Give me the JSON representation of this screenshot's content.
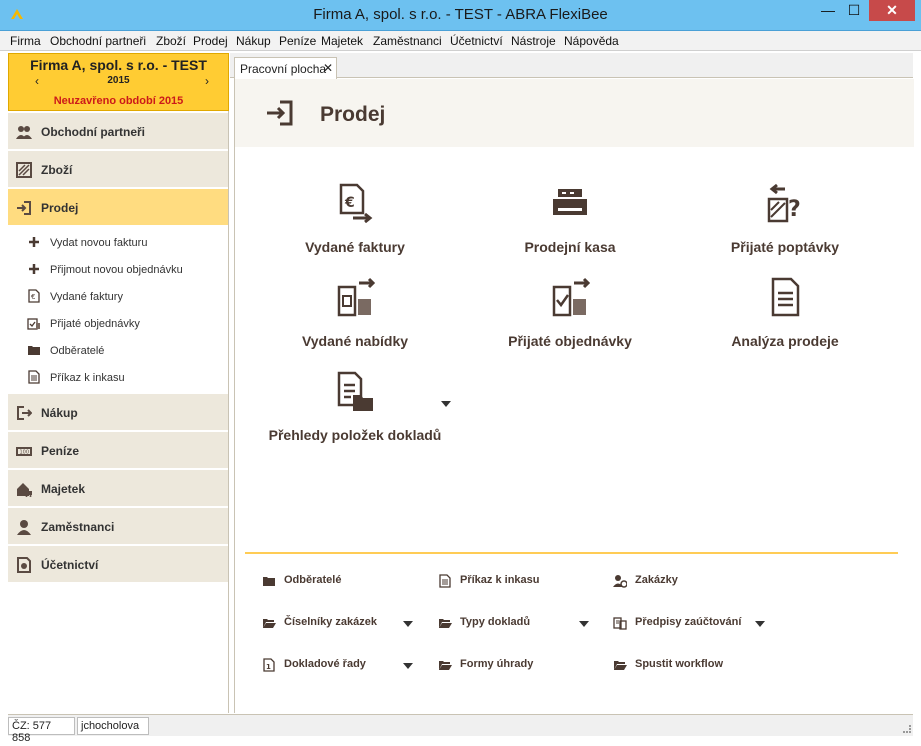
{
  "window": {
    "title": "Firma A, spol. s r.o. - TEST - ABRA FlexiBee",
    "min_glyph": "—",
    "max_glyph": "☐",
    "close_glyph": "✕"
  },
  "menu": [
    "Firma",
    "Obchodní partneři",
    "Zboží",
    "Prodej",
    "Nákup",
    "Peníze",
    "Majetek",
    "Zaměstnanci",
    "Účetnictví",
    "Nástroje",
    "Nápověda"
  ],
  "company": {
    "name": "Firma A, spol. s r.o. - TEST",
    "year": "2015",
    "period": "Neuzavřeno období 2015",
    "prev": "‹",
    "next": "›"
  },
  "sidebar": {
    "modules": [
      {
        "label": "Obchodní partneři",
        "icon": "partners-icon"
      },
      {
        "label": "Zboží",
        "icon": "goods-icon"
      },
      {
        "label": "Prodej",
        "icon": "sales-icon",
        "active": true
      },
      {
        "label": "Nákup",
        "icon": "purchase-icon"
      },
      {
        "label": "Peníze",
        "icon": "money-icon"
      },
      {
        "label": "Majetek",
        "icon": "property-icon"
      },
      {
        "label": "Zaměstnanci",
        "icon": "employees-icon"
      },
      {
        "label": "Účetnictví",
        "icon": "accounting-icon"
      }
    ],
    "subitems": [
      {
        "label": "Vydat novou fakturu",
        "icon": "plus-icon"
      },
      {
        "label": "Přijmout novou objednávku",
        "icon": "plus-icon"
      },
      {
        "label": "Vydané faktury",
        "icon": "invoice-icon"
      },
      {
        "label": "Přijaté objednávky",
        "icon": "order-icon"
      },
      {
        "label": "Odběratelé",
        "icon": "folder-icon"
      },
      {
        "label": "Příkaz k inkasu",
        "icon": "document-icon"
      }
    ]
  },
  "tab": {
    "label": "Pracovní plocha",
    "close": "✕"
  },
  "page": {
    "title": "Prodej"
  },
  "tiles": [
    {
      "label": "Vydané faktury",
      "icon": "issued-invoice-icon"
    },
    {
      "label": "Prodejní kasa",
      "icon": "cash-register-icon"
    },
    {
      "label": "Přijaté poptávky",
      "icon": "received-inquiry-icon"
    },
    {
      "label": "Vydané nabídky",
      "icon": "issued-offer-icon"
    },
    {
      "label": "Přijaté objednávky",
      "icon": "received-order-icon"
    },
    {
      "label": "Analýza prodeje",
      "icon": "sales-analysis-icon"
    },
    {
      "label": "Přehledy položek dokladů",
      "icon": "document-items-icon"
    }
  ],
  "links": [
    {
      "label": "Odběratelé",
      "icon": "folder-icon"
    },
    {
      "label": "Příkaz k inkasu",
      "icon": "document-icon"
    },
    {
      "label": "Zakázky",
      "icon": "contracts-icon"
    },
    {
      "label": "Číselníky zakázek",
      "icon": "folder-open-icon"
    },
    {
      "label": "Typy dokladů",
      "icon": "folder-open-icon"
    },
    {
      "label": "Předpisy zaúčtování",
      "icon": "posting-rules-icon"
    },
    {
      "label": "Dokladové řady",
      "icon": "document-series-icon"
    },
    {
      "label": "Formy úhrady",
      "icon": "folder-open-icon"
    },
    {
      "label": "Spustit workflow",
      "icon": "folder-open-icon"
    }
  ],
  "status": {
    "cz": "ČZ: 577 858",
    "user": "jchocholova"
  },
  "colors": {
    "accent": "#ffcc33",
    "active": "#ffdc80",
    "brand_text": "#4a3a32",
    "warning": "#cc1a1a"
  }
}
